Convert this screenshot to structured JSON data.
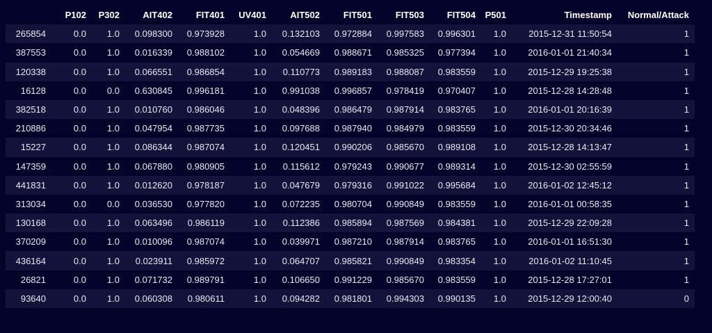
{
  "table": {
    "columns": [
      "",
      "P102",
      "P302",
      "AIT402",
      "FIT401",
      "UV401",
      "AIT502",
      "FIT501",
      "FIT503",
      "FIT504",
      "P501",
      "Timestamp",
      "Normal/Attack"
    ],
    "rows": [
      [
        "265854",
        "0.0",
        "1.0",
        "0.098300",
        "0.973928",
        "1.0",
        "0.132103",
        "0.972884",
        "0.997583",
        "0.996301",
        "1.0",
        "2015-12-31 11:50:54",
        "1"
      ],
      [
        "387553",
        "0.0",
        "1.0",
        "0.016339",
        "0.988102",
        "1.0",
        "0.054669",
        "0.988671",
        "0.985325",
        "0.977394",
        "1.0",
        "2016-01-01 21:40:34",
        "1"
      ],
      [
        "120338",
        "0.0",
        "1.0",
        "0.066551",
        "0.986854",
        "1.0",
        "0.110773",
        "0.989183",
        "0.988087",
        "0.983559",
        "1.0",
        "2015-12-29 19:25:38",
        "1"
      ],
      [
        "16128",
        "0.0",
        "0.0",
        "0.630845",
        "0.996181",
        "1.0",
        "0.991038",
        "0.996857",
        "0.978419",
        "0.970407",
        "1.0",
        "2015-12-28 14:28:48",
        "1"
      ],
      [
        "382518",
        "0.0",
        "1.0",
        "0.010760",
        "0.986046",
        "1.0",
        "0.048396",
        "0.986479",
        "0.987914",
        "0.983765",
        "1.0",
        "2016-01-01 20:16:39",
        "1"
      ],
      [
        "210886",
        "0.0",
        "1.0",
        "0.047954",
        "0.987735",
        "1.0",
        "0.097688",
        "0.987940",
        "0.984979",
        "0.983559",
        "1.0",
        "2015-12-30 20:34:46",
        "1"
      ],
      [
        "15227",
        "0.0",
        "1.0",
        "0.086344",
        "0.987074",
        "1.0",
        "0.120451",
        "0.990206",
        "0.985670",
        "0.989108",
        "1.0",
        "2015-12-28 14:13:47",
        "1"
      ],
      [
        "147359",
        "0.0",
        "1.0",
        "0.067880",
        "0.980905",
        "1.0",
        "0.115612",
        "0.979243",
        "0.990677",
        "0.989314",
        "1.0",
        "2015-12-30 02:55:59",
        "1"
      ],
      [
        "441831",
        "0.0",
        "1.0",
        "0.012620",
        "0.978187",
        "1.0",
        "0.047679",
        "0.979316",
        "0.991022",
        "0.995684",
        "1.0",
        "2016-01-02 12:45:12",
        "1"
      ],
      [
        "313034",
        "0.0",
        "0.0",
        "0.036530",
        "0.977820",
        "1.0",
        "0.072235",
        "0.980704",
        "0.990849",
        "0.983559",
        "1.0",
        "2016-01-01 00:58:35",
        "1"
      ],
      [
        "130168",
        "0.0",
        "1.0",
        "0.063496",
        "0.986119",
        "1.0",
        "0.112386",
        "0.985894",
        "0.987569",
        "0.984381",
        "1.0",
        "2015-12-29 22:09:28",
        "1"
      ],
      [
        "370209",
        "0.0",
        "1.0",
        "0.010096",
        "0.987074",
        "1.0",
        "0.039971",
        "0.987210",
        "0.987914",
        "0.983765",
        "1.0",
        "2016-01-01 16:51:30",
        "1"
      ],
      [
        "436164",
        "0.0",
        "1.0",
        "0.023911",
        "0.985972",
        "1.0",
        "0.064707",
        "0.985821",
        "0.990849",
        "0.983354",
        "1.0",
        "2016-01-02 11:10:45",
        "1"
      ],
      [
        "26821",
        "0.0",
        "1.0",
        "0.071732",
        "0.989791",
        "1.0",
        "0.106650",
        "0.991229",
        "0.985670",
        "0.983559",
        "1.0",
        "2015-12-28 17:27:01",
        "1"
      ],
      [
        "93640",
        "0.0",
        "1.0",
        "0.060308",
        "0.980611",
        "1.0",
        "0.094282",
        "0.981801",
        "0.994303",
        "0.990135",
        "1.0",
        "2015-12-29 12:00:40",
        "0"
      ]
    ]
  }
}
